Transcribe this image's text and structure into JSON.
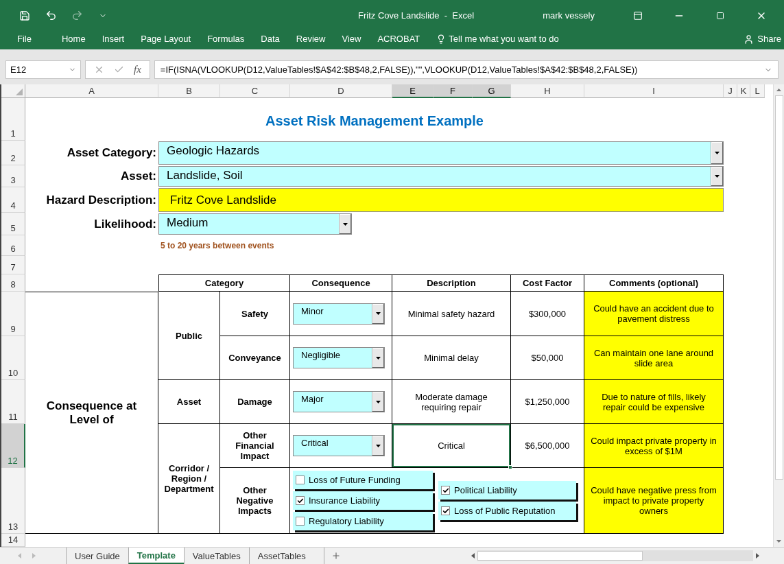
{
  "window": {
    "title": "Fritz Cove Landslide  -  Excel",
    "user": "mark vessely"
  },
  "ribbon": {
    "tabs": [
      "File",
      "Home",
      "Insert",
      "Page Layout",
      "Formulas",
      "Data",
      "Review",
      "View",
      "ACROBAT"
    ],
    "tell_me": "Tell me what you want to do",
    "share": "Share"
  },
  "formula_bar": {
    "name_box": "E12",
    "fx": "fx",
    "formula": "=IF(ISNA(VLOOKUP(D12,ValueTables!$A$42:$B$48,2,FALSE)),\"\",VLOOKUP(D12,ValueTables!$A$42:$B$48,2,FALSE))"
  },
  "columns": [
    {
      "label": "A",
      "selected": false
    },
    {
      "label": "B",
      "selected": false
    },
    {
      "label": "C",
      "selected": false
    },
    {
      "label": "D",
      "selected": false
    },
    {
      "label": "E",
      "selected": true
    },
    {
      "label": "F",
      "selected": true
    },
    {
      "label": "G",
      "selected": true
    },
    {
      "label": "H",
      "selected": false
    },
    {
      "label": "I",
      "selected": false
    },
    {
      "label": "J",
      "selected": false
    },
    {
      "label": "K",
      "selected": false
    },
    {
      "label": "L",
      "selected": false
    }
  ],
  "row_numbers": [
    {
      "label": "1",
      "selected": false
    },
    {
      "label": "2",
      "selected": false
    },
    {
      "label": "3",
      "selected": false
    },
    {
      "label": "4",
      "selected": false
    },
    {
      "label": "5",
      "selected": false
    },
    {
      "label": "6",
      "selected": false
    },
    {
      "label": "7",
      "selected": false
    },
    {
      "label": "8",
      "selected": false
    },
    {
      "label": "9",
      "selected": false
    },
    {
      "label": "10",
      "selected": false
    },
    {
      "label": "11",
      "selected": false
    },
    {
      "label": "12",
      "selected": true
    },
    {
      "label": "13",
      "selected": false
    },
    {
      "label": "14",
      "selected": false
    }
  ],
  "sheet": {
    "title": "Asset Risk Management Example",
    "fields": [
      {
        "label": "Asset Category:",
        "value": "Geologic Hazards",
        "kind": "dropdown"
      },
      {
        "label": "Asset:",
        "value": "Landslide, Soil",
        "kind": "dropdown"
      },
      {
        "label": "Hazard Description:",
        "value": "Fritz Cove Landslide",
        "kind": "text"
      },
      {
        "label": "Likelihood:",
        "value": "Medium",
        "kind": "dropdown"
      }
    ],
    "hint": "5 to 20 years between events"
  },
  "table": {
    "headers": [
      "Category",
      "Consequence",
      "Description",
      "Cost Factor",
      "Comments (optional)"
    ],
    "row_label": "Consequence at Level of",
    "groups": [
      {
        "label": "Public",
        "items": [
          {
            "kind": "dropdown",
            "label": "Safety",
            "consequence": "Minor",
            "description": "Minimal safety hazard",
            "cost": "$300,000",
            "comment": "Could have an accident due to pavement distress",
            "selected": false
          },
          {
            "kind": "dropdown",
            "label": "Conveyance",
            "consequence": "Negligible",
            "description": "Minimal delay",
            "cost": "$50,000",
            "comment": "Can maintain one lane around slide area",
            "selected": false
          }
        ]
      },
      {
        "label": "Asset",
        "items": [
          {
            "kind": "dropdown",
            "label": "Damage",
            "consequence": "Major",
            "description": "Moderate damage requiring repair",
            "cost": "$1,250,000",
            "comment": "Due to nature of fills, likely repair could be expensive",
            "selected": false
          }
        ]
      },
      {
        "label": "Corridor / Region / Department",
        "items": [
          {
            "kind": "dropdown",
            "label": "Other Financial Impact",
            "consequence": "Critical",
            "description": "Critical",
            "cost": "$6,500,000",
            "comment": "Could impact private property in excess of $1M",
            "selected": true
          },
          {
            "kind": "checkboxes",
            "label": "Other Negative Impacts",
            "checkbox_columns": [
              [
                {
                  "label": "Loss of Future Funding",
                  "checked": false
                },
                {
                  "label": "Insurance Liability",
                  "checked": true
                },
                {
                  "label": "Regulatory Liability",
                  "checked": false
                }
              ],
              [
                {
                  "label": "Political Liability",
                  "checked": true
                },
                {
                  "label": "Loss of Public Reputation",
                  "checked": true
                }
              ]
            ],
            "comment": "Could have negative press from impact to private property owners"
          }
        ]
      }
    ]
  },
  "sheet_tabs": [
    {
      "label": "User Guide",
      "selected": false
    },
    {
      "label": "Template",
      "selected": true
    },
    {
      "label": "ValueTables",
      "selected": false
    },
    {
      "label": "AssetTables",
      "selected": false
    }
  ]
}
